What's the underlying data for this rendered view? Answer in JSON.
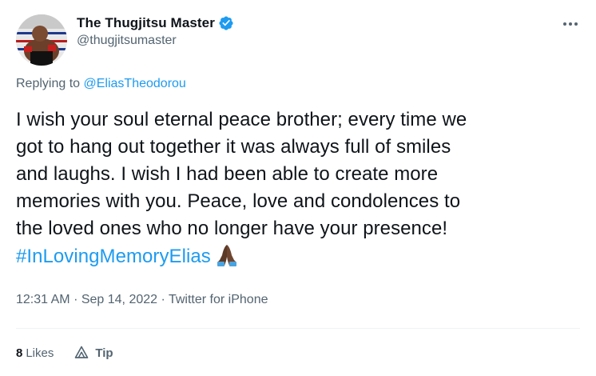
{
  "author": {
    "display_name": "The Thugjitsu Master",
    "handle": "@thugjitsumaster",
    "avatar": "wrestler-avatar",
    "verified_icon": "verified-badge-icon",
    "accent_color": "#1d9bf0"
  },
  "reply": {
    "prefix": "Replying to",
    "mention": "@EliasTheodorou"
  },
  "tweet": {
    "lines": [
      "I wish your soul eternal peace brother; every time we",
      "got to hang out together it was always full of smiles",
      "and laughs. I wish I had been able to create more",
      "memories with you. Peace, love and condolences to",
      "the loved ones who no longer have your presence!"
    ],
    "hashtag": "#InLovingMemoryElias",
    "emoji": "folded-hands-emoji"
  },
  "meta": {
    "time": "12:31 AM",
    "separator": "·",
    "date": "Sep 14, 2022",
    "source": "Twitter for iPhone"
  },
  "stats": {
    "likes_count": "8",
    "likes_label": "Likes",
    "tip_label": "Tip"
  },
  "icons": {
    "more": "more-options-icon",
    "tip": "tip-icon"
  }
}
